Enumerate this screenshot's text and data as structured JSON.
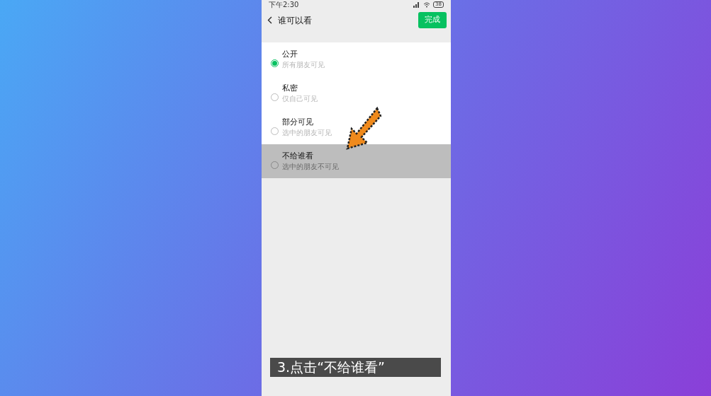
{
  "status_bar": {
    "time": "下午2:30",
    "battery": "38"
  },
  "header": {
    "title": "谁可以看",
    "done_button": "完成"
  },
  "options": [
    {
      "label": "公开",
      "description": "所有朋友可见",
      "selected": true,
      "highlighted": false
    },
    {
      "label": "私密",
      "description": "仅自己可见",
      "selected": false,
      "highlighted": false
    },
    {
      "label": "部分可见",
      "description": "选中的朋友可见",
      "selected": false,
      "highlighted": false
    },
    {
      "label": "不给谁看",
      "description": "选中的朋友不可见",
      "selected": false,
      "highlighted": true
    }
  ],
  "caption": "3.点击“不给谁看”"
}
